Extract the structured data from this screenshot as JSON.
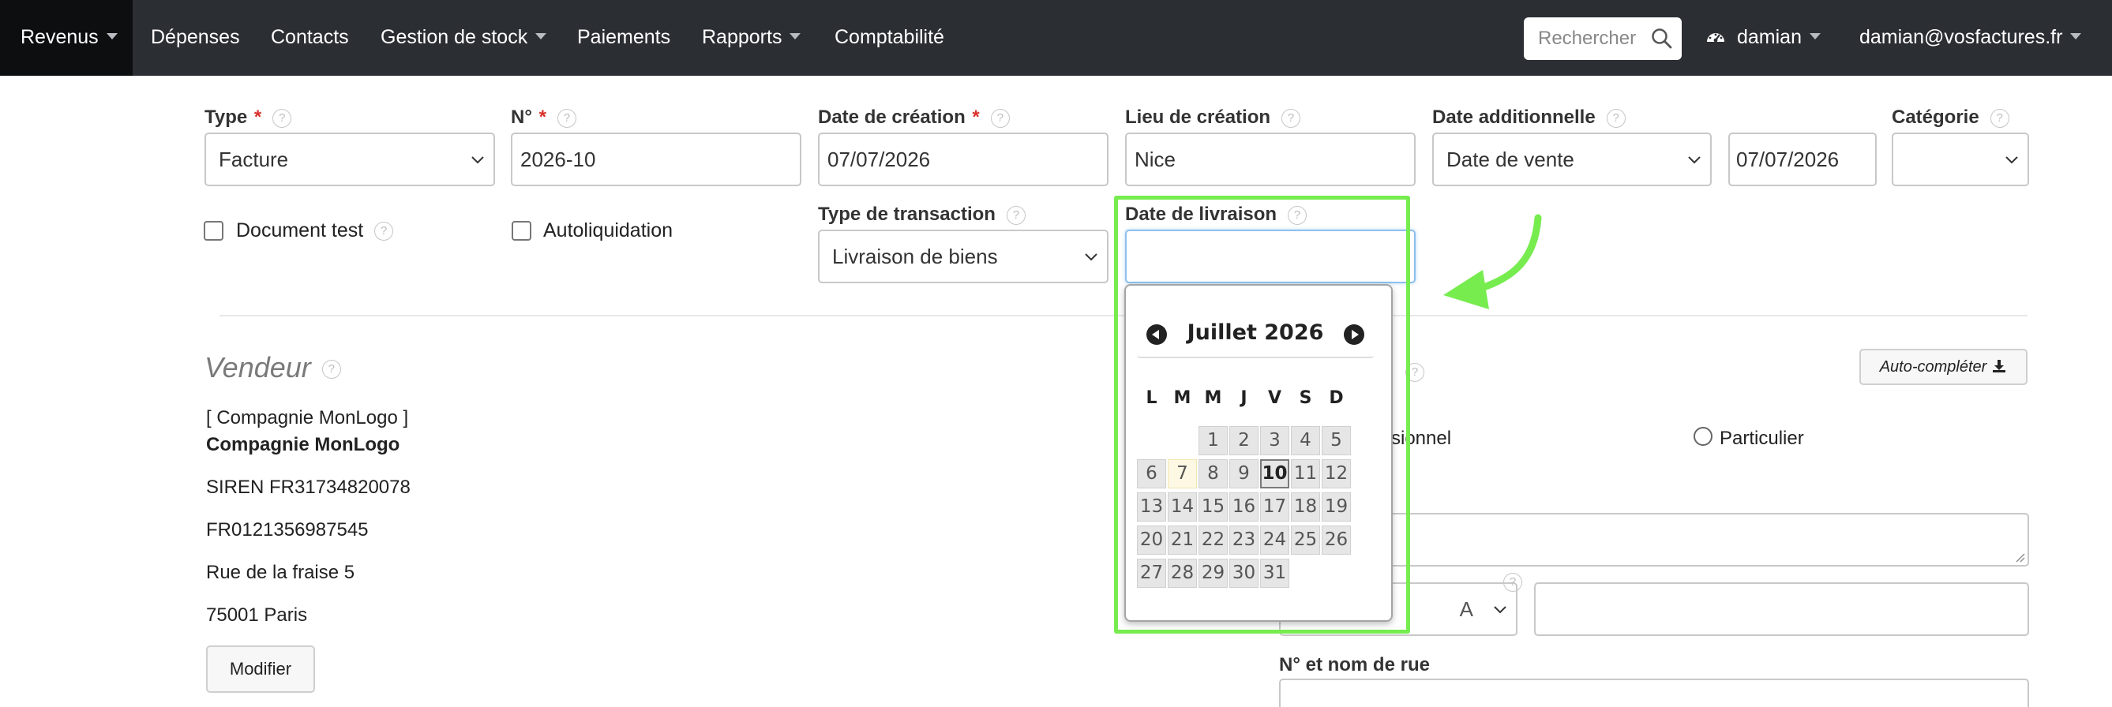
{
  "nav": {
    "items": [
      {
        "label": "Revenus"
      },
      {
        "label": "Dépenses"
      },
      {
        "label": "Contacts"
      },
      {
        "label": "Gestion de stock"
      },
      {
        "label": "Paiements"
      },
      {
        "label": "Rapports"
      },
      {
        "label": "Comptabilité"
      }
    ],
    "search_placeholder": "Rechercher",
    "user": "damian",
    "account": "damian@vosfactures.fr"
  },
  "form": {
    "type": {
      "label": "Type",
      "required": "*",
      "value": "Facture"
    },
    "number": {
      "label": "N°",
      "required": "*",
      "value": "2026-10"
    },
    "creation_date": {
      "label": "Date de création",
      "required": "*",
      "value": "07/07/2026"
    },
    "place": {
      "label": "Lieu de création",
      "value": "Nice"
    },
    "additional_date": {
      "label": "Date additionnelle",
      "select_value": "Date de vente",
      "value": "07/07/2026"
    },
    "category": {
      "label": "Catégorie",
      "value": ""
    },
    "test_document": {
      "label": "Document test"
    },
    "reverse_charge": {
      "label": "Autoliquidation"
    },
    "transaction_type": {
      "label": "Type de transaction",
      "value": "Livraison de biens"
    },
    "delivery_date": {
      "label": "Date de livraison",
      "value": ""
    }
  },
  "help_icon": "?",
  "datepicker": {
    "title": "Juillet 2026",
    "weekdays": [
      "L",
      "M",
      "M",
      "J",
      "V",
      "S",
      "D"
    ],
    "weeks": [
      [
        "",
        "",
        "1",
        "2",
        "3",
        "4",
        "5"
      ],
      [
        "6",
        "7",
        "8",
        "9",
        "10",
        "11",
        "12"
      ],
      [
        "13",
        "14",
        "15",
        "16",
        "17",
        "18",
        "19"
      ],
      [
        "20",
        "21",
        "22",
        "23",
        "24",
        "25",
        "26"
      ],
      [
        "27",
        "28",
        "29",
        "30",
        "31",
        "",
        ""
      ]
    ],
    "today": "7",
    "selected": "10"
  },
  "seller": {
    "title": "Vendeur",
    "company_bracket": "[ Compagnie MonLogo ]",
    "company": "Compagnie MonLogo",
    "siren": "SIREN FR31734820078",
    "vat": "FR0121356987545",
    "street": "Rue de la fraise 5",
    "city": "75001 Paris",
    "edit_button": "Modifier"
  },
  "buyer": {
    "autocomplete_button": "Auto-compléter",
    "professional_partial": "sionnel",
    "individual": "Particulier",
    "country_partial": "A",
    "street_label": "N° et nom de rue"
  },
  "colors": {
    "nav_bg": "#2b2e33",
    "highlight": "#77ec4f",
    "required": "#d9312b"
  }
}
